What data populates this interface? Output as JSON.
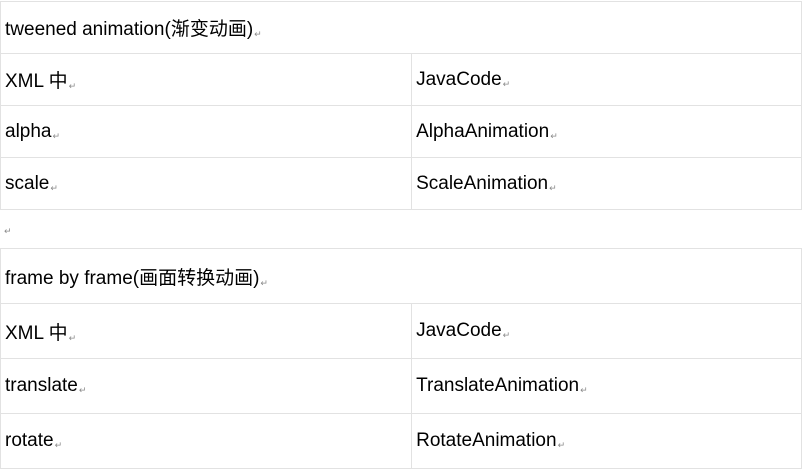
{
  "tables": [
    {
      "heading": "tweened animation(渐变动画)",
      "rows": [
        [
          "XML 中",
          "JavaCode"
        ],
        [
          "alpha",
          "AlphaAnimation"
        ],
        [
          "scale",
          "ScaleAnimation"
        ]
      ]
    },
    {
      "heading": "frame by frame(画面转换动画)",
      "rows": [
        [
          "XML 中",
          "JavaCode"
        ],
        [
          "translate",
          "TranslateAnimation"
        ],
        [
          "rotate",
          "RotateAnimation"
        ]
      ]
    }
  ],
  "marks": {
    "paragraph": "↵"
  }
}
